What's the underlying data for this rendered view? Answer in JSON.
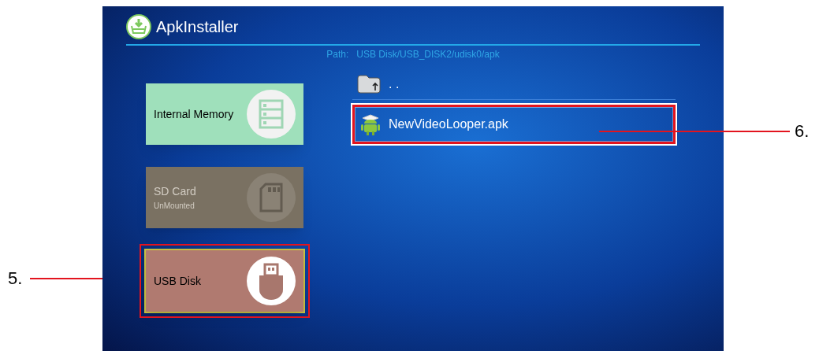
{
  "window": {
    "title": "ApkInstaller"
  },
  "path": {
    "label": "Path:",
    "value": "USB Disk/USB_DISK2/udisk0/apk"
  },
  "devices": [
    {
      "kind": "memory",
      "name": "Internal Memory",
      "color": "#9fe0bb",
      "disabled": false,
      "selected": false
    },
    {
      "kind": "sdcard",
      "name": "SD Card",
      "status": "UnMounted",
      "color": "#7a7162",
      "disabled": true,
      "selected": false
    },
    {
      "kind": "usb",
      "name": "USB Disk",
      "color": "#b07a70",
      "disabled": false,
      "selected": true
    }
  ],
  "files": [
    {
      "kind": "parent",
      "name": ". .",
      "selected": false
    },
    {
      "kind": "apk",
      "name": "NewVideoLooper.apk",
      "selected": true
    }
  ],
  "callouts": [
    {
      "label": "5."
    },
    {
      "label": "6."
    }
  ]
}
